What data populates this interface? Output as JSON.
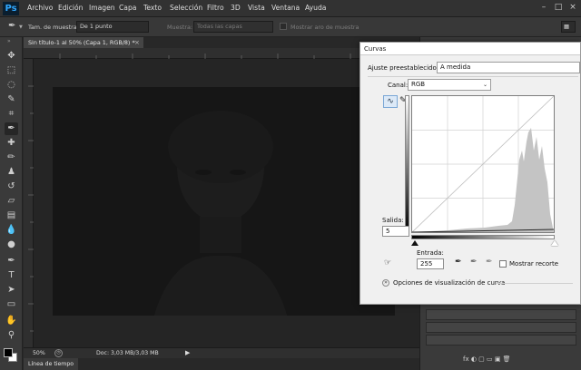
{
  "app": {
    "logo": "Ps"
  },
  "menubar": {
    "items": [
      "Archivo",
      "Edición",
      "Imagen",
      "Capa",
      "Texto",
      "Selección",
      "Filtro",
      "3D",
      "Vista",
      "Ventana",
      "Ayuda"
    ]
  },
  "options": {
    "sample_size_label": "Tam. de muestra:",
    "sample_size_value": "De 1 punto",
    "sample_label": "Muestra:",
    "sample_value": "Todas las capas",
    "show_ring_label": "Mostrar aro de muestra"
  },
  "document": {
    "tab_title": "Sin título-1 al 50% (Capa 1, RGB/8) *",
    "zoom": "50%",
    "doc_info": "Doc: 3,03 MB/3,03 MB"
  },
  "bottom": {
    "timeline_tab": "Línea de tiempo"
  },
  "curves": {
    "title": "Curvas",
    "preset_label": "Ajuste preestablecido:",
    "preset_value": "A medida",
    "channel_label": "Canal:",
    "channel_value": "RGB",
    "output_label": "Salida:",
    "output_value": "5",
    "input_label": "Entrada:",
    "input_value": "255",
    "show_clipping_label": "Mostrar recorte",
    "display_options_label": "Opciones de visualización de curva"
  },
  "icons": {
    "move": "✥",
    "marquee": "⬚",
    "lasso": "◌",
    "quick-select": "✎",
    "crop": "⌗",
    "eyedropper": "✒",
    "heal": "✚",
    "brush": "✏",
    "stamp": "♟",
    "history-brush": "↺",
    "eraser": "▱",
    "gradient": "▤",
    "blur": "💧",
    "dodge": "●",
    "pen": "✒",
    "type": "T",
    "path-select": "➤",
    "shape": "▭",
    "hand": "✋",
    "zoom": "⚲",
    "close": "×",
    "minimize": "–",
    "maximize": "□",
    "expand": "»",
    "curve-edit": "∿",
    "pencil": "✎",
    "target-adjust": "☞",
    "triangle-right": "▶",
    "panel-icons": "fx ◐ ▢ ▭ ▣ 🗑"
  },
  "colors": {
    "accent_blue": "#31a8ff",
    "dialog_bg": "#f0f0f0",
    "canvas_bg": "#161616"
  }
}
